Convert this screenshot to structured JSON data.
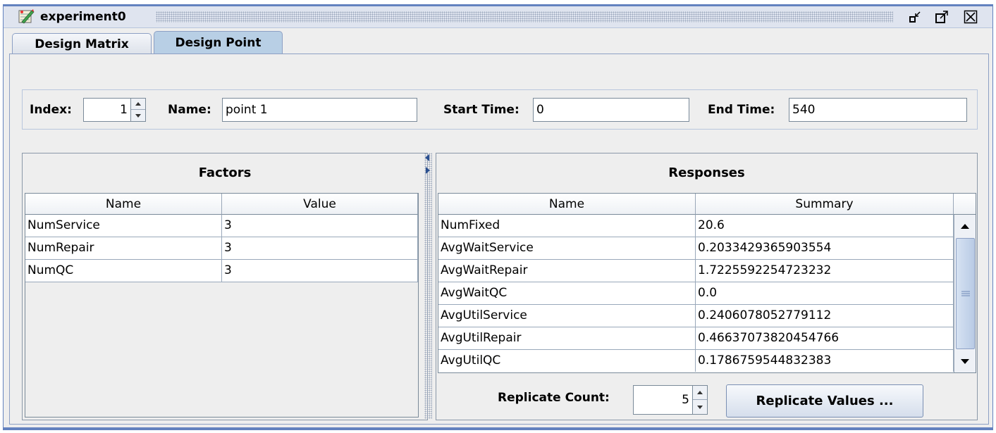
{
  "window": {
    "title": "experiment0",
    "buttons": {
      "minimize": "minimize-icon",
      "maximize": "maximize-icon",
      "close": "close-icon"
    }
  },
  "tabs": [
    {
      "label": "Design Matrix",
      "active": false
    },
    {
      "label": "Design Point",
      "active": true
    }
  ],
  "fields": {
    "index_label": "Index:",
    "index_value": "1",
    "name_label": "Name:",
    "name_value": "point 1",
    "start_label": "Start Time:",
    "start_value": "0",
    "end_label": "End Time:",
    "end_value": "540"
  },
  "factors": {
    "title": "Factors",
    "columns": [
      "Name",
      "Value"
    ],
    "rows": [
      [
        "NumService",
        "3"
      ],
      [
        "NumRepair",
        "3"
      ],
      [
        "NumQC",
        "3"
      ]
    ]
  },
  "responses": {
    "title": "Responses",
    "columns": [
      "Name",
      "Summary"
    ],
    "rows": [
      [
        "NumFixed",
        "20.6"
      ],
      [
        "AvgWaitService",
        "0.2033429365903554"
      ],
      [
        "AvgWaitRepair",
        "1.7225592254723232"
      ],
      [
        "AvgWaitQC",
        "0.0"
      ],
      [
        "AvgUtilService",
        "0.2406078052779112"
      ],
      [
        "AvgUtilRepair",
        "0.46637073820454766"
      ],
      [
        "AvgUtilQC",
        "0.1786759544832383"
      ]
    ]
  },
  "replicate": {
    "count_label": "Replicate Count:",
    "count_value": "5",
    "values_button": "Replicate Values ..."
  },
  "colors": {
    "frame_border": "#6382bf",
    "active_tab": "#b8cfe5",
    "background": "#eeeeee"
  }
}
